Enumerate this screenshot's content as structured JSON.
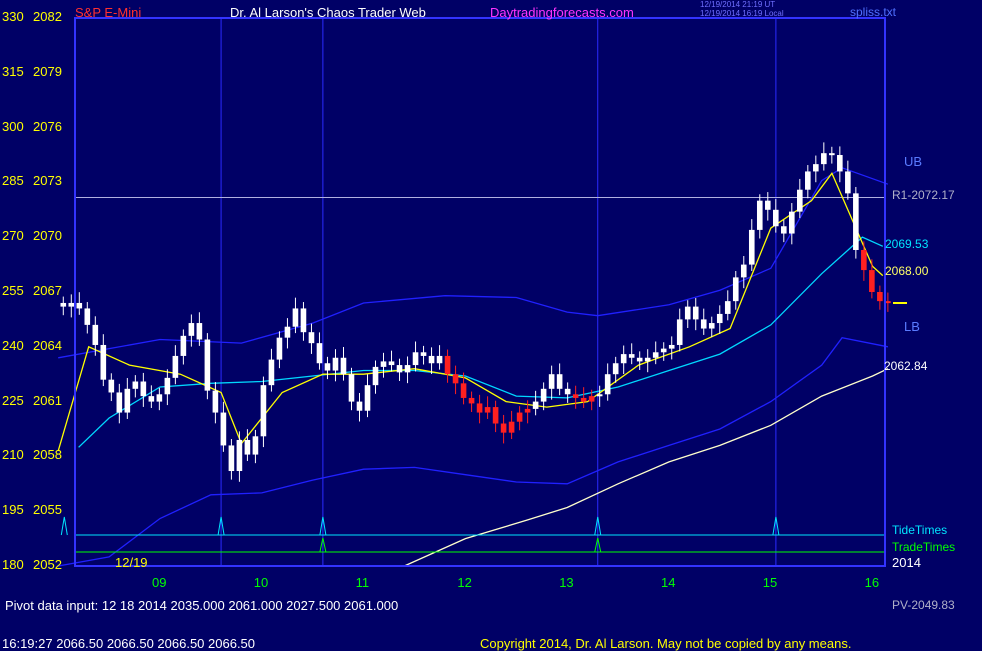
{
  "header": {
    "symbol": "S&P E-Mini",
    "title": "Dr. Al Larson's Chaos Trader Web",
    "website": "Daytradingforecasts.com",
    "ut_stamp": "12/19/2014 21:19 UT",
    "local_stamp": "12/19/2014 16:19 Local",
    "file": "spliss.txt"
  },
  "left_axis": {
    "degrees": [
      "330",
      "315",
      "300",
      "285",
      "270",
      "255",
      "240",
      "225",
      "210",
      "195",
      "180"
    ],
    "prices": [
      "2082",
      "2079",
      "2076",
      "2073",
      "2070",
      "2067",
      "2064",
      "2061",
      "2058",
      "2055",
      "2052"
    ]
  },
  "x_axis": {
    "labels": [
      "09",
      "10",
      "11",
      "12",
      "13",
      "14",
      "15",
      "16"
    ],
    "year": "2014",
    "date_label": "12/19"
  },
  "annotations": {
    "ub": "UB",
    "lb": "LB",
    "r1": "R1-2072.17",
    "level_2069": "2069.53",
    "level_2068": "2068.00",
    "level_2062": "2062.84",
    "tide_times": "TideTimes",
    "trade_times": "TradeTimes"
  },
  "footer": {
    "pivot": "Pivot data input: 12 18 2014  2035.000  2061.000  2027.500   2061.000",
    "pv": "PV-2049.83",
    "quote": "16:19:27  2066.50  2066.50  2066.50  2066.50",
    "copyright": "Copyright 2014, Dr. Al Larson. May not be copied by any means."
  },
  "colors": {
    "background": "#000066",
    "up_bar": "#ffffff",
    "down_bar": "#ff2020",
    "band": "#2020ff",
    "cyan_line": "#00d8ff",
    "yellow_line": "#ffff00",
    "slow_line": "#ffffcc",
    "tide": "#00e5ff",
    "trade": "#00ff00",
    "r1": "#b0b0e0"
  },
  "chart_data": {
    "type": "candlestick",
    "instrument": "S&P E-Mini",
    "y_range": [
      2052,
      2082
    ],
    "x_hours": [
      "09",
      "10",
      "11",
      "12",
      "13",
      "14",
      "15",
      "16"
    ],
    "r1": 2072.17,
    "series": [
      {
        "name": "UB",
        "x": [
          8.0,
          9.0,
          9.8,
          10.5,
          11.0,
          11.8,
          12.5,
          13.0,
          13.3,
          14.0,
          14.5,
          15.0,
          15.5,
          15.7,
          16.15
        ],
        "values": [
          2063.4,
          2064.4,
          2064.2,
          2065.3,
          2066.4,
          2066.8,
          2066.7,
          2065.9,
          2065.7,
          2066.3,
          2067.1,
          2068.3,
          2073.1,
          2073.8,
          2072.9
        ]
      },
      {
        "name": "LB",
        "x": [
          8.0,
          8.5,
          9.0,
          9.5,
          10.0,
          10.5,
          11.0,
          11.5,
          12.0,
          12.5,
          13.0,
          13.5,
          14.0,
          14.5,
          15.0,
          15.5,
          15.7,
          16.15
        ],
        "values": [
          2052.0,
          2052.5,
          2054.6,
          2055.9,
          2056.0,
          2056.7,
          2057.3,
          2057.4,
          2057.0,
          2056.6,
          2056.5,
          2057.7,
          2058.6,
          2059.5,
          2061.0,
          2063.0,
          2064.5,
          2064.0
        ]
      },
      {
        "name": "Cyan average",
        "x": [
          8.2,
          8.5,
          9.0,
          9.5,
          10.0,
          10.5,
          11.0,
          11.5,
          12.0,
          12.5,
          13.0,
          13.5,
          14.0,
          14.5,
          15.0,
          15.5,
          15.9,
          16.1
        ],
        "values": [
          2058.5,
          2060.1,
          2061.8,
          2062.0,
          2062.1,
          2062.4,
          2062.7,
          2062.7,
          2062.4,
          2061.3,
          2061.2,
          2061.8,
          2062.7,
          2063.6,
          2065.2,
          2068.0,
          2070.0,
          2069.5
        ]
      },
      {
        "name": "Yellow average",
        "x": [
          8.0,
          8.3,
          8.7,
          9.2,
          9.6,
          9.8,
          10.2,
          10.6,
          11.0,
          11.5,
          12.0,
          12.4,
          12.8,
          13.2,
          13.7,
          14.2,
          14.6,
          15.0,
          15.4,
          15.6,
          16.0,
          16.1
        ],
        "values": [
          2058.3,
          2064.0,
          2063.0,
          2062.5,
          2061.5,
          2058.7,
          2061.5,
          2062.5,
          2062.5,
          2062.8,
          2062.3,
          2061.0,
          2060.7,
          2061.0,
          2063.0,
          2064.0,
          2065.0,
          2070.5,
          2072.0,
          2073.5,
          2068.4,
          2067.9
        ]
      },
      {
        "name": "Slow average",
        "x": [
          11.4,
          12.0,
          12.6,
          13.0,
          13.5,
          14.0,
          14.5,
          15.0,
          15.5,
          16.0,
          16.15
        ],
        "values": [
          2052.0,
          2053.5,
          2054.5,
          2055.2,
          2056.5,
          2057.7,
          2058.6,
          2059.7,
          2061.3,
          2062.4,
          2062.8
        ]
      }
    ],
    "tide_times": [
      8.06,
      9.6,
      10.6,
      13.3,
      15.05
    ],
    "trade_times": [
      10.6,
      13.3
    ],
    "bars_hours": [
      8.05,
      16.15
    ],
    "bar_closes": [
      2066.2,
      2066.4,
      2066.1,
      2065.2,
      2064.1,
      2062.2,
      2061.5,
      2060.4,
      2061.7,
      2062.1,
      2061.3,
      2061.0,
      2061.4,
      2062.3,
      2063.5,
      2064.6,
      2065.3,
      2064.4,
      2061.6,
      2060.4,
      2058.6,
      2057.2,
      2058.9,
      2058.1,
      2059.1,
      2061.9,
      2063.3,
      2064.5,
      2065.1,
      2066.1,
      2064.8,
      2064.2,
      2063.1,
      2062.7,
      2063.4,
      2062.5,
      2061.0,
      2060.5,
      2061.9,
      2062.9,
      2063.2,
      2063.0,
      2062.6,
      2063.0,
      2063.7,
      2063.5,
      2063.1,
      2063.5,
      2062.5,
      2062.0,
      2061.2,
      2060.9,
      2060.4,
      2060.7,
      2059.8,
      2059.3,
      2059.9,
      2060.4,
      2060.6,
      2061.0,
      2061.7,
      2062.5,
      2061.7,
      2061.4,
      2061.2,
      2061.0,
      2061.3,
      2061.4,
      2062.5,
      2063.1,
      2063.6,
      2063.4,
      2063.2,
      2063.4,
      2063.7,
      2063.9,
      2064.1,
      2065.5,
      2066.2,
      2065.5,
      2065.0,
      2065.3,
      2065.8,
      2066.5,
      2067.8,
      2068.5,
      2070.4,
      2072.0,
      2071.5,
      2070.6,
      2070.2,
      2071.4,
      2072.6,
      2073.6,
      2074.0,
      2074.6,
      2074.5,
      2073.6,
      2072.4,
      2069.3,
      2068.2,
      2067.0,
      2066.5,
      2066.5
    ],
    "down_segments": [
      [
        48,
        58
      ],
      [
        64,
        66
      ],
      [
        100,
        103
      ]
    ]
  }
}
